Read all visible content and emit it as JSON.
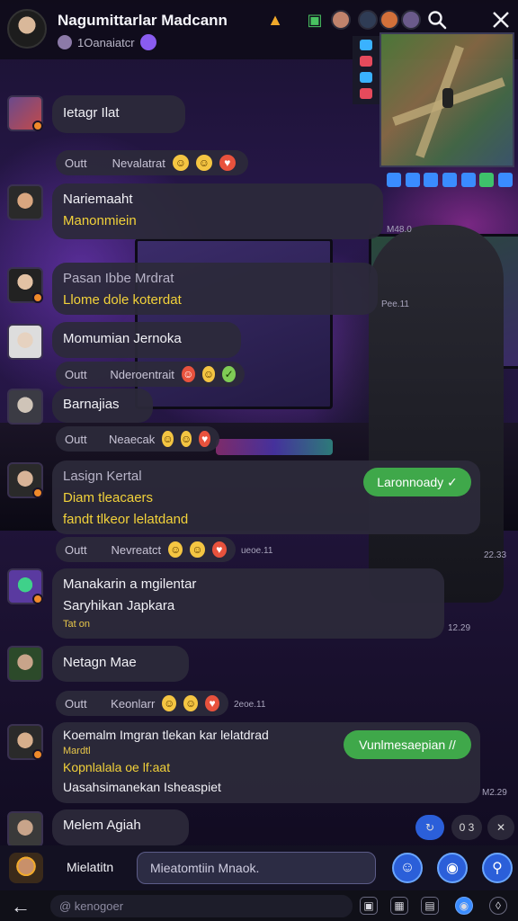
{
  "header": {
    "title": "Nagumittarlar Madcann",
    "subtitle": "1Oanaiatcr"
  },
  "messages": [
    {
      "lines": [
        "Ietagr Ilat"
      ]
    },
    {
      "react_label": "Outt",
      "react_text": "Nevalatrat"
    },
    {
      "lines": [
        "Nariemaaht",
        "Manonmiein"
      ]
    },
    {
      "lines": [
        "Pasan Ibbe Mrdrat",
        "Llome dole koterdat"
      ]
    },
    {
      "lines": [
        "Momumian Jernoka"
      ]
    },
    {
      "react_label": "Outt",
      "react_text": "Nderoentrait"
    },
    {
      "lines": [
        "Barnajias"
      ]
    },
    {
      "react_label": "Outt",
      "react_text": "Neaecak"
    },
    {
      "lines": [
        "Lasign Kertal",
        "Diam tleacaers",
        "fandt tlkeor lelatdand"
      ],
      "pill": "Laronnoady ✓"
    },
    {
      "react_label": "Outt",
      "react_text": "Nevreatct"
    },
    {
      "lines": [
        "Manakarin a mgilentar",
        "Saryhikan Japkara",
        "Tat on"
      ]
    },
    {
      "lines": [
        "Netagn Mae"
      ]
    },
    {
      "react_label": "Outt",
      "react_text": "Keonlarr"
    },
    {
      "lines": [
        "Koemalm Imgran tlekan kar lelatdrad",
        "Mardtl",
        "Kopnlalala oe lf:aat",
        "Uasahsimanekan Isheaspiet"
      ],
      "pill": "Vunlmesaepian //"
    },
    {
      "lines": [
        "Melem Agiah"
      ]
    }
  ],
  "timestamps": [
    "M48.0",
    "Pee.11",
    "ueoe.11",
    "22.33",
    "12.29",
    "2eoe.11",
    "M2.29"
  ],
  "float_pill": "0 3",
  "composer": {
    "me_name": "Mielatitn",
    "input_value": "Mieatomtiin Mnaok."
  },
  "navbar": {
    "url": "@ kenogoer"
  },
  "colors": {
    "accent": "#3fa84a",
    "button": "#2b5fd9",
    "bubble": "#2c2a3a"
  },
  "icons": [
    "flame-icon",
    "chat-icon",
    "search-icon",
    "close-icon",
    "back-arrow-icon"
  ]
}
